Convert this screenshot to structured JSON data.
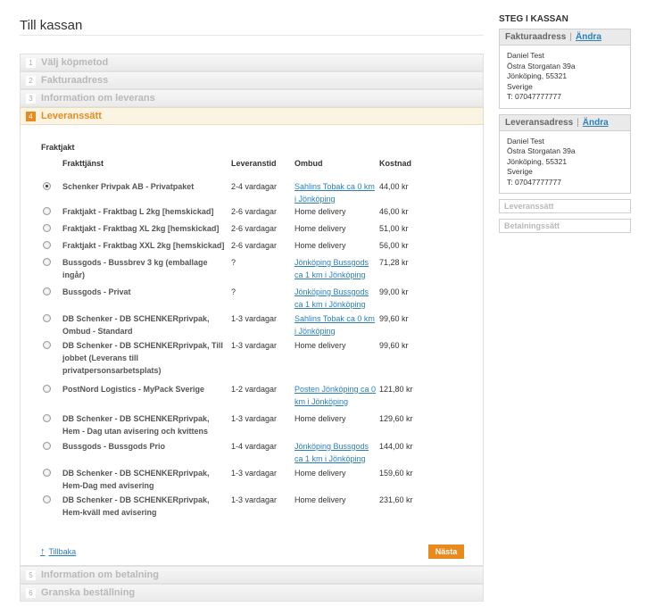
{
  "page_title": "Till kassan",
  "steps_before": [
    {
      "num": "1",
      "title": "Välj köpmetod"
    },
    {
      "num": "2",
      "title": "Fakturaadress"
    },
    {
      "num": "3",
      "title": "Information om leverans"
    }
  ],
  "active_step": {
    "num": "4",
    "title": "Leveranssätt"
  },
  "steps_after": [
    {
      "num": "5",
      "title": "Information om betalning"
    },
    {
      "num": "6",
      "title": "Granska beställning"
    }
  ],
  "shipping": {
    "group_label": "Fraktjakt",
    "headers": {
      "service": "Frakttjänst",
      "time": "Leveranstid",
      "agent": "Ombud",
      "cost": "Kostnad"
    },
    "options": [
      {
        "service": "Schenker Privpak AB - Privatpaket",
        "time": "2-4 vardagar",
        "agent": "Sahlins Tobak ca 0 km i Jönköping",
        "agent_is_link": true,
        "cost": "44,00 kr",
        "selected": true
      },
      {
        "service": "Fraktjakt - Fraktbag L 2kg [hemskickad]",
        "time": "2-6 vardagar",
        "agent": "Home delivery",
        "agent_is_link": false,
        "cost": "46,00 kr",
        "selected": false
      },
      {
        "service": "Fraktjakt - Fraktbag XL 2kg [hemskickad]",
        "time": "2-6 vardagar",
        "agent": "Home delivery",
        "agent_is_link": false,
        "cost": "51,00 kr",
        "selected": false
      },
      {
        "service": "Fraktjakt - Fraktbag XXL 2kg [hemskickad]",
        "time": "2-6 vardagar",
        "agent": "Home delivery",
        "agent_is_link": false,
        "cost": "56,00 kr",
        "selected": false
      },
      {
        "service": "Bussgods - Bussbrev 3 kg (emballage ingår)",
        "time": "?",
        "agent": "Jönköping Bussgods ca 1 km i Jönköping",
        "agent_is_link": true,
        "cost": "71,28 kr",
        "selected": false
      },
      {
        "service": "Bussgods - Privat",
        "time": "?",
        "agent": "Jönköping Bussgods ca 1 km i Jönköping",
        "agent_is_link": true,
        "cost": "99,00 kr",
        "selected": false
      },
      {
        "service": "DB Schenker - DB SCHENKERprivpak, Ombud - Standard",
        "time": "1-3 vardagar",
        "agent": "Sahlins Tobak ca 0 km i Jönköping",
        "agent_is_link": true,
        "cost": "99,60 kr",
        "selected": false
      },
      {
        "service": "DB Schenker - DB SCHENKERprivpak, Till jobbet (Leverans till privatpersonsarbetsplats)",
        "time": "1-3 vardagar",
        "agent": "Home delivery",
        "agent_is_link": false,
        "cost": "99,60 kr",
        "selected": false
      },
      {
        "service": "PostNord Logistics - MyPack Sverige",
        "time": "1-2 vardagar",
        "agent": "Posten Jönköping ca 0 km i Jönköping",
        "agent_is_link": true,
        "cost": "121,80 kr",
        "selected": false
      },
      {
        "service": "DB Schenker - DB SCHENKERprivpak, Hem - Dag utan avisering och kvittens",
        "time": "1-3 vardagar",
        "agent": "Home delivery",
        "agent_is_link": false,
        "cost": "129,60 kr",
        "selected": false
      },
      {
        "service": "Bussgods - Bussgods Prio",
        "time": "1-4 vardagar",
        "agent": "Jönköping Bussgods ca 1 km i Jönköping",
        "agent_is_link": true,
        "cost": "144,00 kr",
        "selected": false
      },
      {
        "service": "DB Schenker - DB SCHENKERprivpak, Hem-Dag med avisering",
        "time": "1-3 vardagar",
        "agent": "Home delivery",
        "agent_is_link": false,
        "cost": "159,60 kr",
        "selected": false
      },
      {
        "service": "DB Schenker - DB SCHENKERprivpak, Hem-kväll med avisering",
        "time": "1-3 vardagar",
        "agent": "Home delivery",
        "agent_is_link": false,
        "cost": "231,60 kr",
        "selected": false
      }
    ],
    "back_label": "Tillbaka",
    "next_label": "Nästa"
  },
  "sidebar": {
    "title": "STEG I KASSAN",
    "billing": {
      "title": "Fakturaadress",
      "separator": "|",
      "edit_label": "Ändra",
      "lines": [
        "Daniel Test",
        "Östra Storgatan 39a",
        "Jönköping, 55321",
        "Sverige",
        "T: 07047777777"
      ]
    },
    "shipping": {
      "title": "Leveransadress",
      "separator": "|",
      "edit_label": "Ändra",
      "lines": [
        "Daniel Test",
        "Östra Storgatan 39a",
        "Jönköping, 55321",
        "Sverige",
        "T: 07047777777"
      ]
    },
    "method_label": "Leveranssätt",
    "payment_label": "Betalningssätt"
  }
}
